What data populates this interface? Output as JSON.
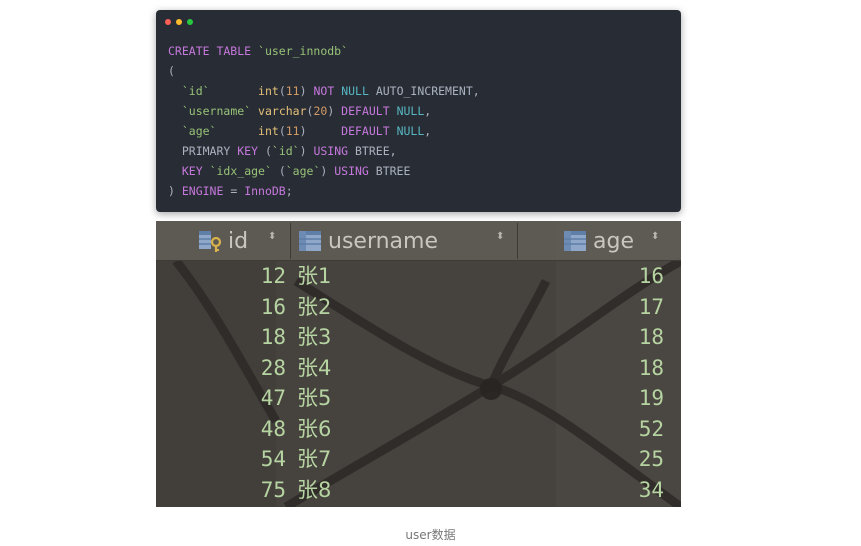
{
  "code_window": {
    "buttons": [
      {
        "name": "close",
        "color": "#ff5f56"
      },
      {
        "name": "minimize",
        "color": "#ffbd2e"
      },
      {
        "name": "maximize",
        "color": "#27c93f"
      }
    ],
    "lines": [
      [
        {
          "t": "CREATE TABLE ",
          "c": "kw"
        },
        {
          "t": "`user_innodb`",
          "c": "str"
        }
      ],
      [
        {
          "t": "(",
          "c": ""
        }
      ],
      [
        {
          "t": "  ",
          "c": ""
        },
        {
          "t": "`id`",
          "c": "str"
        },
        {
          "t": "       ",
          "c": ""
        },
        {
          "t": "int",
          "c": "typ"
        },
        {
          "t": "(",
          "c": ""
        },
        {
          "t": "11",
          "c": "num"
        },
        {
          "t": ") ",
          "c": ""
        },
        {
          "t": "NOT",
          "c": "kw"
        },
        {
          "t": " ",
          "c": ""
        },
        {
          "t": "NULL",
          "c": "nul"
        },
        {
          "t": " AUTO_INCREMENT,",
          "c": ""
        }
      ],
      [
        {
          "t": "  ",
          "c": ""
        },
        {
          "t": "`username`",
          "c": "str"
        },
        {
          "t": " ",
          "c": ""
        },
        {
          "t": "varchar",
          "c": "typ"
        },
        {
          "t": "(",
          "c": ""
        },
        {
          "t": "20",
          "c": "num"
        },
        {
          "t": ") ",
          "c": ""
        },
        {
          "t": "DEFAULT",
          "c": "kw"
        },
        {
          "t": " ",
          "c": ""
        },
        {
          "t": "NULL",
          "c": "nul"
        },
        {
          "t": ",",
          "c": ""
        }
      ],
      [
        {
          "t": "  ",
          "c": ""
        },
        {
          "t": "`age`",
          "c": "str"
        },
        {
          "t": "      ",
          "c": ""
        },
        {
          "t": "int",
          "c": "typ"
        },
        {
          "t": "(",
          "c": ""
        },
        {
          "t": "11",
          "c": "num"
        },
        {
          "t": ")     ",
          "c": ""
        },
        {
          "t": "DEFAULT",
          "c": "kw"
        },
        {
          "t": " ",
          "c": ""
        },
        {
          "t": "NULL",
          "c": "nul"
        },
        {
          "t": ",",
          "c": ""
        }
      ],
      [
        {
          "t": "  PRIMARY ",
          "c": ""
        },
        {
          "t": "KEY",
          "c": "kw"
        },
        {
          "t": " (",
          "c": ""
        },
        {
          "t": "`id`",
          "c": "str"
        },
        {
          "t": ") ",
          "c": ""
        },
        {
          "t": "USING",
          "c": "kw"
        },
        {
          "t": " BTREE,",
          "c": ""
        }
      ],
      [
        {
          "t": "  ",
          "c": ""
        },
        {
          "t": "KEY",
          "c": "kw"
        },
        {
          "t": " ",
          "c": ""
        },
        {
          "t": "`idx_age`",
          "c": "str"
        },
        {
          "t": " (",
          "c": ""
        },
        {
          "t": "`age`",
          "c": "str"
        },
        {
          "t": ") ",
          "c": ""
        },
        {
          "t": "USING",
          "c": "kw"
        },
        {
          "t": " BTREE",
          "c": ""
        }
      ],
      [
        {
          "t": ") ",
          "c": ""
        },
        {
          "t": "ENGINE",
          "c": "kw"
        },
        {
          "t": " = ",
          "c": ""
        },
        {
          "t": "InnoDB",
          "c": "kw"
        },
        {
          "t": ";",
          "c": ""
        }
      ]
    ]
  },
  "grid": {
    "columns": [
      {
        "key": "id",
        "label": "id",
        "icon": "primary-key-column-icon"
      },
      {
        "key": "username",
        "label": "username",
        "icon": "column-icon"
      },
      {
        "key": "age",
        "label": "age",
        "icon": "column-icon"
      }
    ],
    "sort_glyph": "⬍",
    "rows": [
      {
        "id": "12",
        "username": "张1",
        "age": "16"
      },
      {
        "id": "16",
        "username": "张2",
        "age": "17"
      },
      {
        "id": "18",
        "username": "张3",
        "age": "18"
      },
      {
        "id": "28",
        "username": "张4",
        "age": "18"
      },
      {
        "id": "47",
        "username": "张5",
        "age": "19"
      },
      {
        "id": "48",
        "username": "张6",
        "age": "52"
      },
      {
        "id": "54",
        "username": "张7",
        "age": "25"
      },
      {
        "id": "75",
        "username": "张8",
        "age": "34"
      }
    ]
  },
  "caption": "user数据"
}
